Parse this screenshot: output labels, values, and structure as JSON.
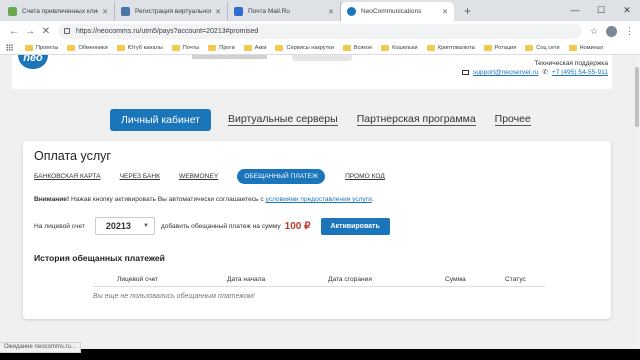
{
  "browser": {
    "tabs": [
      {
        "title": "Счета привлеченных клиентов",
        "color": "#6aa84f",
        "active": false
      },
      {
        "title": "Регистрация виртуального серв",
        "color": "#4a76a8",
        "active": false
      },
      {
        "title": "Почта Mail.Ru",
        "color": "#2c6cd1",
        "active": false
      },
      {
        "title": "NeoCommunications",
        "color": "#1b75bb",
        "active": true
      }
    ],
    "new_tab_glyph": "+",
    "url": "https://neocomms.ru/utm5/pays?account=20213#promised",
    "bookmarks": [
      "Проекты",
      "Обменники",
      "Ютуб каналы",
      "Почты",
      "Проги",
      "Акки",
      "Сервисы накрутки",
      "Всякое",
      "Кошельки",
      "Криптовалюта",
      "Ротация",
      "Соц сети",
      "Номинал"
    ],
    "status_text": "Ожидание neocomms.ru..."
  },
  "site": {
    "support_label": "Техническая поддержка",
    "support_email": "support@neoserver.ru",
    "support_phone": "+7 (495) 54-55-911",
    "nav": {
      "cabinet": "Личный кабинет",
      "servers": "Виртуальные серверы",
      "partner": "Партнерская программа",
      "other": "Прочее"
    }
  },
  "payments": {
    "title": "Оплата услуг",
    "tabs": [
      {
        "label": "БАНКОВСКАЯ КАРТА",
        "active": false
      },
      {
        "label": "ЧЕРЕЗ БАНК",
        "active": false
      },
      {
        "label": "WEBMONEY",
        "active": false
      },
      {
        "label": "ОБЕЩАННЫЙ ПЛАТЕЖ",
        "active": true
      },
      {
        "label": "ПРОМО КОД",
        "active": false
      }
    ],
    "notice_strong": "Внимание!",
    "notice_text": " Нажав кнопку активировать Вы автоматически соглашаетесь с ",
    "notice_link": "условиями предоставления услуги",
    "notice_end": ".",
    "account_label": "На лицевой счет",
    "account_value": "20213",
    "add_label": "добавить обещанный платеж на сумму",
    "amount": "100 ₽",
    "activate_button": "Активировать",
    "history_title": "История обещанных платежей",
    "history_columns": [
      "Лицевой счет",
      "Дата начала",
      "Дата сгорания",
      "Сумма",
      "Статус"
    ],
    "history_empty": "Вы еще не пользовались обещанным платежом!"
  },
  "colors": {
    "brand": "#1b75bb",
    "amount": "#c0392b"
  }
}
